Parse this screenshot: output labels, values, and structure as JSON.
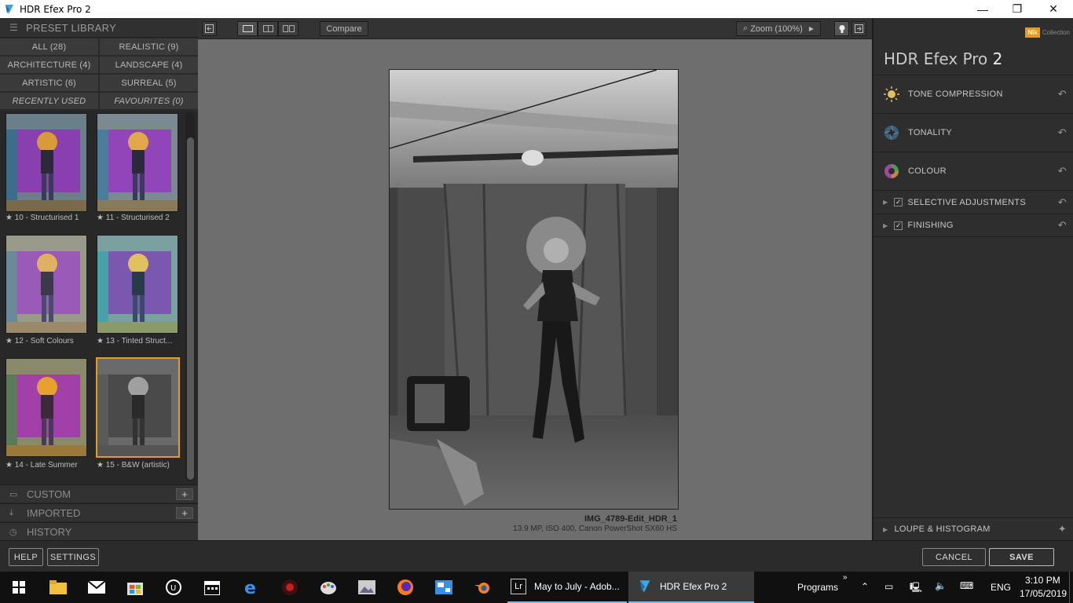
{
  "window": {
    "title": "HDR Efex Pro 2",
    "minimize": "—",
    "restore": "❐",
    "close": "✕"
  },
  "left_panel": {
    "header": "PRESET LIBRARY",
    "categories": [
      {
        "label": "ALL (28)"
      },
      {
        "label": "REALISTIC (9)"
      },
      {
        "label": "ARCHITECTURE (4)"
      },
      {
        "label": "LANDSCAPE (4)"
      },
      {
        "label": "ARTISTIC (6)"
      },
      {
        "label": "SURREAL (5)"
      },
      {
        "label": "RECENTLY USED"
      },
      {
        "label": "FAVOURITES (0)"
      }
    ],
    "presets": [
      {
        "label": "★ 10 - Structurised 1"
      },
      {
        "label": "★ 11 - Structurised 2"
      },
      {
        "label": "★ 12 - Soft Colours"
      },
      {
        "label": "★ 13 - Tinted Struct..."
      },
      {
        "label": "★ 14 - Late Summer"
      },
      {
        "label": "★ 15 - B&W (artistic)"
      }
    ],
    "custom": "CUSTOM",
    "imported": "IMPORTED",
    "history": "HISTORY",
    "plus": "+"
  },
  "toolbar": {
    "compare": "Compare",
    "zoom": "Zoom (100%)"
  },
  "canvas": {
    "file_name": "IMG_4789-Edit_HDR_1",
    "file_meta": "13.9 MP, ISO 400, Canon PowerShot SX60 HS"
  },
  "right_panel": {
    "brand": "Nik",
    "collection": "Collection",
    "title_main": "HDR Efex Pro",
    "title_num": "2",
    "sections": [
      {
        "label": "TONE COMPRESSION"
      },
      {
        "label": "TONALITY"
      },
      {
        "label": "COLOUR"
      },
      {
        "label": "SELECTIVE ADJUSTMENTS"
      },
      {
        "label": "FINISHING"
      }
    ],
    "loupe": "LOUPE & HISTOGRAM"
  },
  "bottom_bar": {
    "help": "HELP",
    "settings": "SETTINGS",
    "cancel": "CANCEL",
    "save": "SAVE"
  },
  "taskbar": {
    "apps": [
      {
        "label": "May to July - Adob..."
      },
      {
        "label": "HDR Efex Pro 2"
      }
    ],
    "programs": "Programs",
    "lang": "ENG",
    "time": "3:10 PM",
    "date": "17/05/2019"
  },
  "colors": {
    "accent": "#e79a1c",
    "canvas_bg": "#6e6e6e",
    "panel_bg": "#2e2e2e"
  }
}
